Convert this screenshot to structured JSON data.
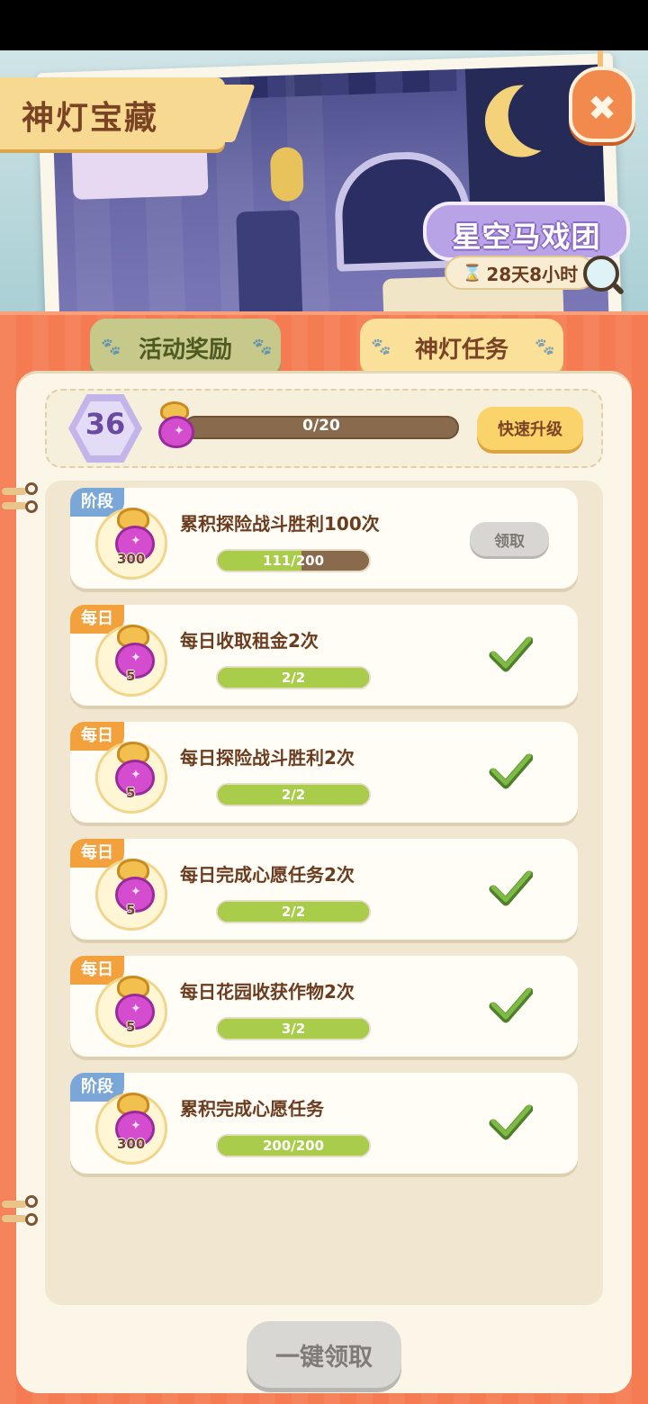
{
  "header": {
    "title": "神灯宝藏",
    "event_name": "星空马戏团",
    "timer": "28天8小时"
  },
  "tabs": [
    {
      "label": "活动奖励",
      "active": false
    },
    {
      "label": "神灯任务",
      "active": true
    }
  ],
  "level": {
    "value": "36",
    "progress_text": "0/20",
    "progress": 0,
    "quick_upgrade_label": "快速升级"
  },
  "tasks": [
    {
      "tag": "阶段",
      "tag_type": "stage",
      "reward_qty": "300",
      "title": "累积探险战斗胜利100次",
      "progress_text": "111/200",
      "progress": 0.555,
      "status": "claim",
      "claim_label": "领取"
    },
    {
      "tag": "每日",
      "tag_type": "daily",
      "reward_qty": "5",
      "title": "每日收取租金2次",
      "progress_text": "2/2",
      "progress": 1,
      "status": "done"
    },
    {
      "tag": "每日",
      "tag_type": "daily",
      "reward_qty": "5",
      "title": "每日探险战斗胜利2次",
      "progress_text": "2/2",
      "progress": 1,
      "status": "done"
    },
    {
      "tag": "每日",
      "tag_type": "daily",
      "reward_qty": "5",
      "title": "每日完成心愿任务2次",
      "progress_text": "2/2",
      "progress": 1,
      "status": "done"
    },
    {
      "tag": "每日",
      "tag_type": "daily",
      "reward_qty": "5",
      "title": "每日花园收获作物2次",
      "progress_text": "3/2",
      "progress": 1,
      "status": "done"
    },
    {
      "tag": "阶段",
      "tag_type": "stage",
      "reward_qty": "300",
      "title": "累积完成心愿任务",
      "progress_text": "200/200",
      "progress": 1,
      "status": "done"
    }
  ],
  "footer": {
    "one_key_claim_label": "一键领取"
  },
  "colors": {
    "panel": "#f47b52",
    "progress_fill": "#a9cd4a",
    "stage_tag": "#7aa6d8",
    "daily_tag": "#f2a13c",
    "check": "#6aa23a"
  }
}
